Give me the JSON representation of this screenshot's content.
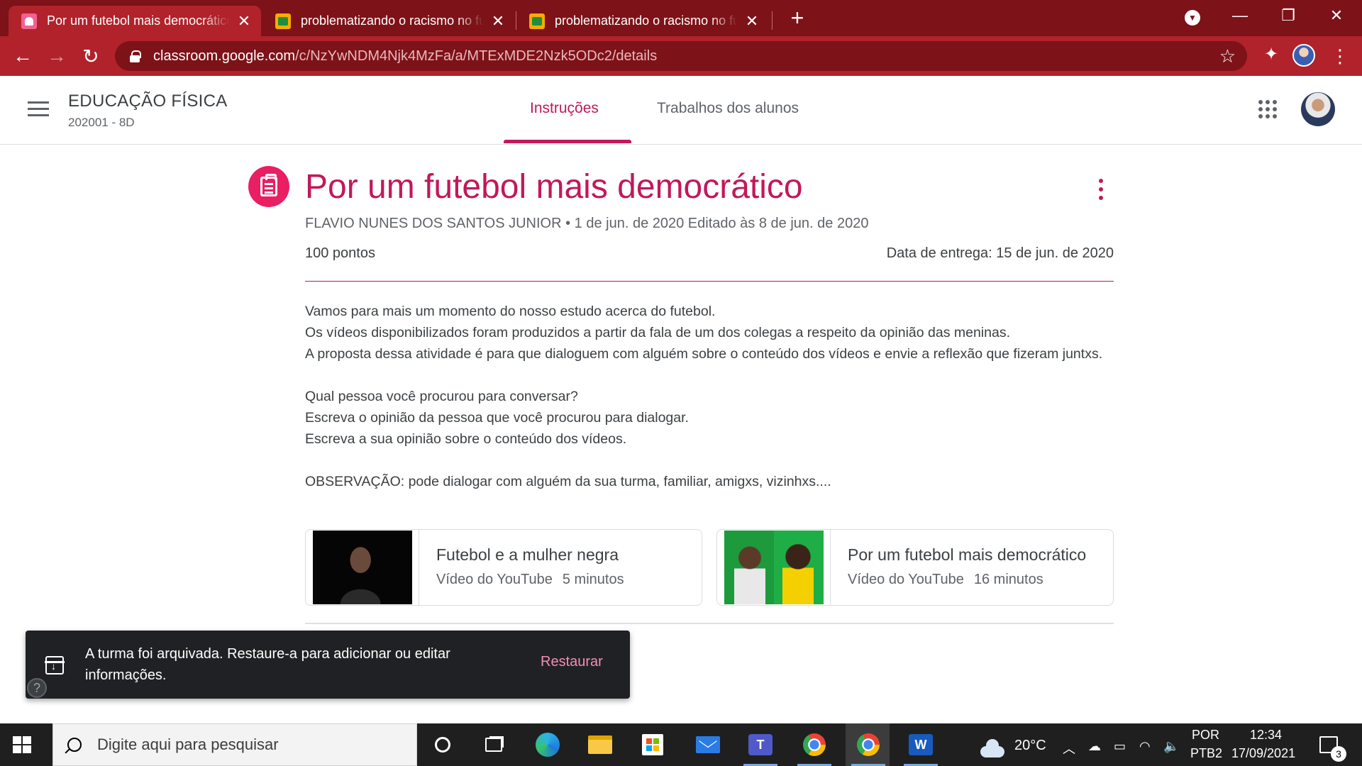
{
  "browser": {
    "tabs": [
      {
        "title": "Por um futebol mais democrático",
        "favicon": "classroom-assignment-icon"
      },
      {
        "title": "problematizando o racismo no futebol",
        "favicon": "classroom-icon"
      },
      {
        "title": "problematizando o racismo no futebol",
        "favicon": "classroom-icon"
      }
    ],
    "url_host": "classroom.google.com",
    "url_path": "/c/NzYwNDM4Njk4MzFa/a/MTExMDE2Nzk5ODc2/details",
    "theme_color": "#b1222b"
  },
  "header": {
    "course_title": "EDUCAÇÃO FÍSICA",
    "course_section": "202001 - 8D",
    "tabs": [
      "Instruções",
      "Trabalhos dos alunos"
    ],
    "accent": "#c2185b"
  },
  "assignment": {
    "title": "Por um futebol mais democrático",
    "meta": "FLAVIO NUNES DOS SANTOS JUNIOR • 1 de jun. de 2020 Editado às 8 de jun. de 2020",
    "points": "100 pontos",
    "due": "Data de entrega: 15 de jun. de 2020",
    "body": [
      "Vamos para mais um momento do nosso estudo acerca do futebol.",
      "Os vídeos disponibilizados foram produzidos a partir da fala de um dos colegas a respeito da opinião das meninas.",
      "A proposta dessa atividade é para que dialoguem com alguém sobre o conteúdo dos vídeos e envie a reflexão que fizeram juntxs.",
      "",
      "Qual pessoa você procurou para conversar?",
      "Escreva o opinião da pessoa que você procurou para dialogar.",
      "Escreva a sua opinião sobre o conteúdo dos vídeos.",
      "",
      "OBSERVAÇÃO: pode dialogar com alguém da sua turma, familiar, amigxs, vizinhxs...."
    ],
    "attachments": [
      {
        "title": "Futebol e a mulher negra",
        "source": "Vídeo do YouTube",
        "duration": "5 minutos"
      },
      {
        "title": "Por um futebol mais democrático",
        "source": "Vídeo do YouTube",
        "duration": "16 minutos"
      }
    ]
  },
  "snackbar": {
    "message": "A turma foi arquivada. Restaure-a para adicionar ou editar informações.",
    "action": "Restaurar"
  },
  "taskbar": {
    "search_placeholder": "Digite aqui para pesquisar",
    "weather": "20°C",
    "language": "POR",
    "keyboard": "PTB2",
    "time": "12:34",
    "date": "17/09/2021",
    "notifications": "3"
  }
}
